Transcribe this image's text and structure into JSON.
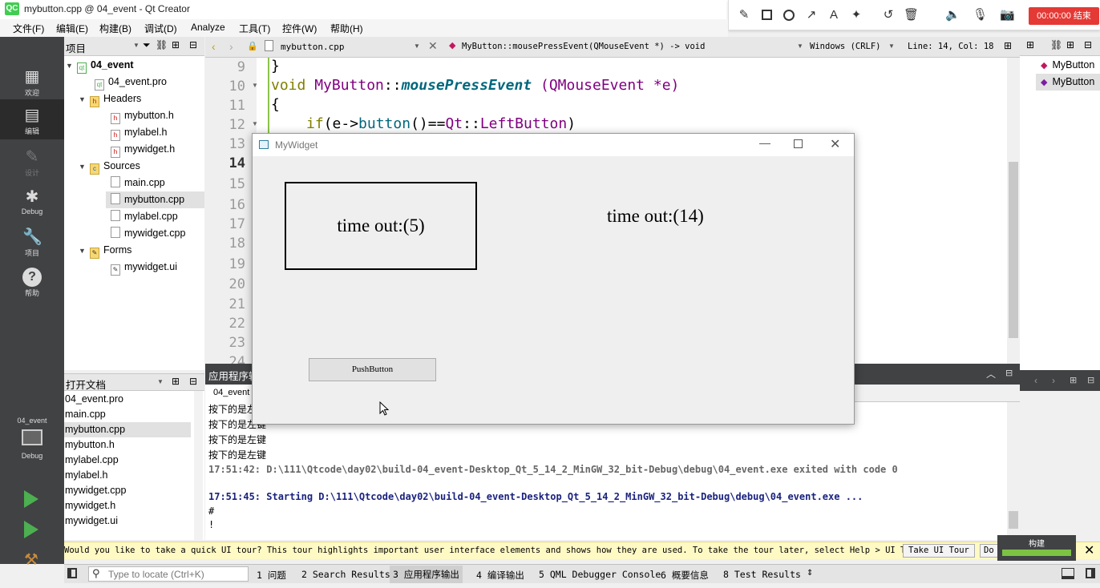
{
  "window": {
    "title": "mybutton.cpp @ 04_event - Qt Creator",
    "app_icon": "QC"
  },
  "recorder": {
    "stop_label": "00:00:00 结束",
    "tools": [
      "pencil-icon",
      "rect-icon",
      "circle-icon",
      "arrow-icon",
      "text-icon",
      "magic-icon",
      "undo-icon",
      "trash-icon",
      "speaker-icon",
      "mic-icon",
      "camera-icon"
    ]
  },
  "menubar": [
    "文件(F)",
    "编辑(E)",
    "构建(B)",
    "调试(D)",
    "Analyze",
    "工具(T)",
    "控件(W)",
    "帮助(H)"
  ],
  "modes": [
    {
      "label": "欢迎",
      "icon": "grid-icon"
    },
    {
      "label": "编辑",
      "icon": "edit-icon"
    },
    {
      "label": "设计",
      "icon": "pen-icon"
    },
    {
      "label": "Debug",
      "icon": "bug-icon"
    },
    {
      "label": "项目",
      "icon": "wrench-icon"
    },
    {
      "label": "帮助",
      "icon": "help-icon"
    }
  ],
  "kit": {
    "project": "04_event",
    "config": "Debug"
  },
  "project_panel": {
    "title": "项目",
    "tree": [
      {
        "label": "04_event",
        "level": 0,
        "bold": true,
        "arrow": "▼"
      },
      {
        "label": "04_event.pro",
        "level": 1
      },
      {
        "label": "Headers",
        "level": 1,
        "arrow": "▼"
      },
      {
        "label": "mybutton.h",
        "level": 2
      },
      {
        "label": "mylabel.h",
        "level": 2
      },
      {
        "label": "mywidget.h",
        "level": 2
      },
      {
        "label": "Sources",
        "level": 1,
        "arrow": "▼"
      },
      {
        "label": "main.cpp",
        "level": 2
      },
      {
        "label": "mybutton.cpp",
        "level": 2,
        "selected": true
      },
      {
        "label": "mylabel.cpp",
        "level": 2
      },
      {
        "label": "mywidget.cpp",
        "level": 2
      },
      {
        "label": "Forms",
        "level": 1,
        "arrow": "▼"
      },
      {
        "label": "mywidget.ui",
        "level": 2
      }
    ]
  },
  "open_docs": {
    "title": "打开文档",
    "items": [
      "04_event.pro",
      "main.cpp",
      "mybutton.cpp",
      "mybutton.h",
      "mylabel.cpp",
      "mylabel.h",
      "mywidget.cpp",
      "mywidget.h",
      "mywidget.ui"
    ],
    "selected": "mybutton.cpp"
  },
  "editor": {
    "file": "mybutton.cpp",
    "symbol": "MyButton::mousePressEvent(QMouseEvent *) -> void",
    "line_ending": "Windows (CRLF)",
    "position": "Line: 14, Col: 18",
    "line_numbers": [
      "9",
      "10",
      "11",
      "12",
      "13",
      "14",
      "15",
      "16",
      "17",
      "18",
      "19",
      "20",
      "21",
      "22",
      "23",
      "24"
    ],
    "code_line_9": "}",
    "code_line_10_void": "void ",
    "code_line_10_class": "MyButton",
    "code_line_10_sep": "::",
    "code_line_10_fn": "mousePressEvent",
    "code_line_10_args": " (QMouseEvent *e)",
    "code_line_11": "{",
    "code_line_12_if": "if",
    "code_line_12_a": "(e->",
    "code_line_12_b": "button",
    "code_line_12_c": "()==",
    "code_line_12_d": "Qt",
    "code_line_12_e": "::",
    "code_line_12_f": "LeftButton",
    "code_line_12_g": ")"
  },
  "outline": {
    "items": [
      "MyButton",
      "MyButton"
    ]
  },
  "output": {
    "title": "应用程序输出",
    "tab": "04_event",
    "lines": [
      {
        "text": "按下的是左键",
        "style": "plain"
      },
      {
        "text": "按下的是左键",
        "style": "plain"
      },
      {
        "text": "按下的是左键",
        "style": "plain"
      },
      {
        "text": "按下的是左键",
        "style": "plain"
      },
      {
        "text": "17:51:42: D:\\111\\Qtcode\\day02\\build-04_event-Desktop_Qt_5_14_2_MinGW_32_bit-Debug\\debug\\04_event.exe exited with code 0",
        "style": "gray"
      },
      {
        "text": "",
        "style": "plain"
      },
      {
        "text": "17:51:45: Starting D:\\111\\Qtcode\\day02\\build-04_event-Desktop_Qt_5_14_2_MinGW_32_bit-Debug\\debug\\04_event.exe ...",
        "style": "blue"
      },
      {
        "text": "#",
        "style": "plain"
      },
      {
        "text": "!",
        "style": "plain"
      }
    ]
  },
  "tour": {
    "text": "Would you like to take a quick UI tour? This tour highlights important user interface elements and shows how they are used. To take the tour later, select Help > UI Tour.",
    "button": "Take UI Tour",
    "button2": "Do"
  },
  "build": {
    "label": "构建",
    "progress": 1.0
  },
  "statusbar": {
    "locate_placeholder": "Type to locate (Ctrl+K)",
    "panes": [
      "1 问题",
      "2 Search Results",
      "3 应用程序输出",
      "4 编译输出",
      "5 QML Debugger Console",
      "6 概要信息",
      "8 Test Results"
    ]
  },
  "mywidget": {
    "title": "MyWidget",
    "label1": "time out:(5)",
    "label2": "time out:(14)",
    "button": "PushButton"
  }
}
